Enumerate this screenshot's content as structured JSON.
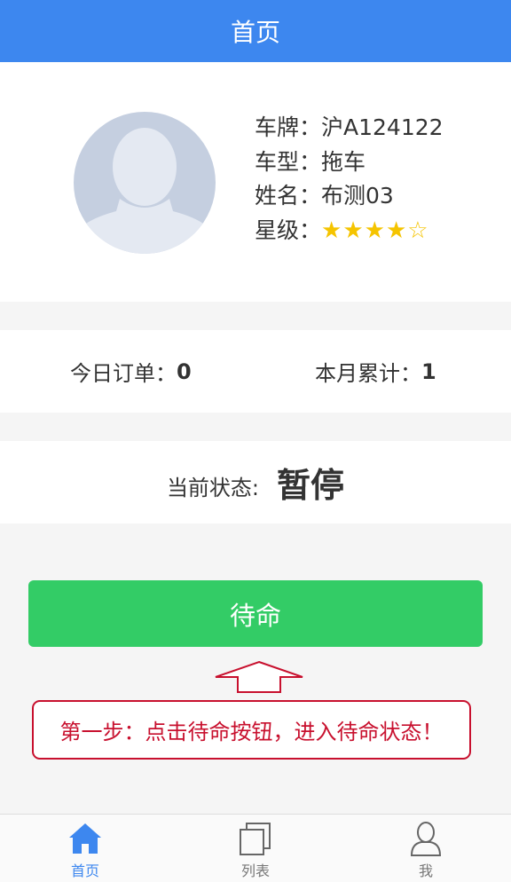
{
  "header": {
    "title": "首页"
  },
  "profile": {
    "plate_label": "车牌：",
    "plate_value": "沪A124122",
    "type_label": "车型：",
    "type_value": "拖车",
    "name_label": "姓名：",
    "name_value": "布测03",
    "rating_label": "星级：",
    "rating_stars": "★★★★☆",
    "rating": 4,
    "rating_max": 5
  },
  "stats": {
    "today_label": "今日订单：",
    "today_value": "0",
    "month_label": "本月累计：",
    "month_value": "1"
  },
  "status": {
    "label": "当前状态:",
    "value": "暂停"
  },
  "actions": {
    "standby_label": "待命"
  },
  "hint": {
    "text": "第一步：点击待命按钮，进入待命状态！"
  },
  "tabbar": {
    "items": [
      {
        "label": "首页",
        "icon": "home-icon",
        "active": true
      },
      {
        "label": "列表",
        "icon": "list-icon",
        "active": false
      },
      {
        "label": "我",
        "icon": "user-icon",
        "active": false
      }
    ]
  },
  "colors": {
    "primary": "#3d87ef",
    "button": "#33cc66",
    "hint": "#c8102e",
    "star": "#f5c400"
  }
}
